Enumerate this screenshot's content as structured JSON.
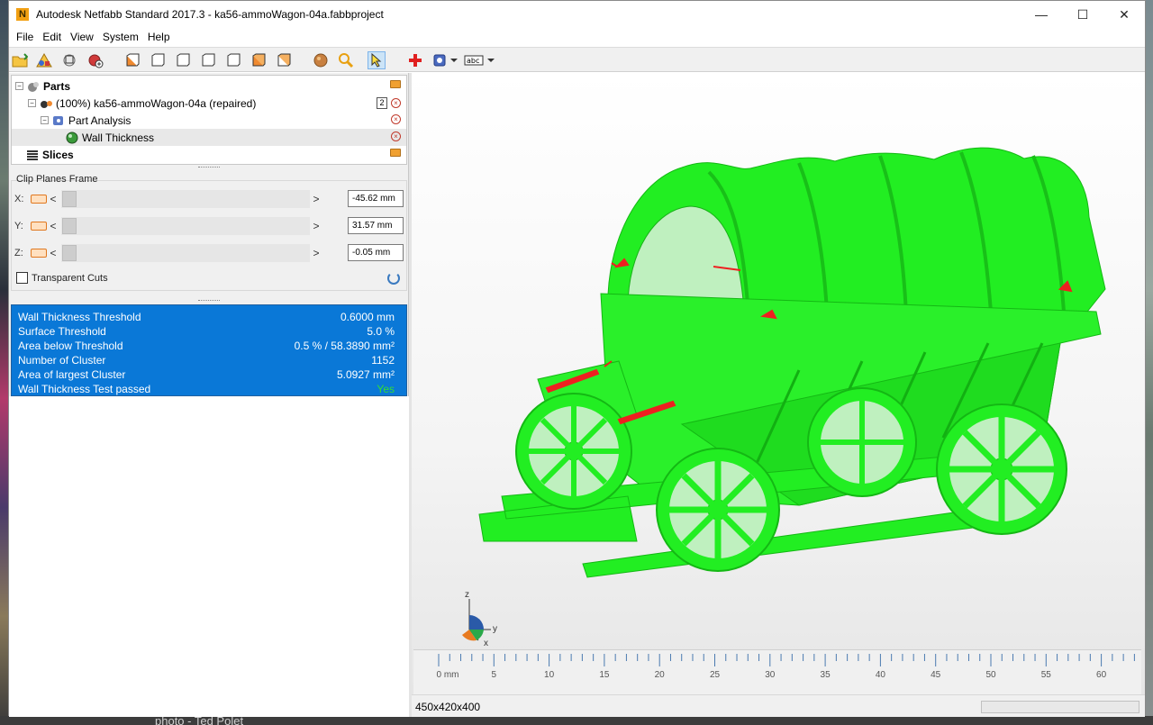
{
  "window": {
    "title": "Autodesk Netfabb Standard 2017.3 - ka56-ammoWagon-04a.fabbproject",
    "logo_letter": "N",
    "minimize": "—",
    "maximize": "☐",
    "close": "✕"
  },
  "menu": [
    "File",
    "Edit",
    "View",
    "System",
    "Help"
  ],
  "tree": {
    "parts_label": "Parts",
    "part_label": "(100%) ka56-ammoWagon-04a (repaired)",
    "part_badge": "2",
    "analysis_label": "Part Analysis",
    "wall_label": "Wall Thickness",
    "slices_label": "Slices"
  },
  "clip": {
    "title": "Clip Planes Frame",
    "x_label": "X:",
    "y_label": "Y:",
    "z_label": "Z:",
    "x_value": "-45.62 mm",
    "y_value": "31.57 mm",
    "z_value": "-0.05 mm",
    "arrow_left": "<",
    "arrow_right": ">",
    "transparent_label": "Transparent Cuts"
  },
  "results": [
    {
      "label": "Wall Thickness Threshold",
      "value": "0.6000 mm"
    },
    {
      "label": "Surface Threshold",
      "value": "5.0 %"
    },
    {
      "label": "Area below Threshold",
      "value": "0.5 % /  58.3890 mm²"
    },
    {
      "label": "Number of Cluster",
      "value": "1152"
    },
    {
      "label": "Area of largest Cluster",
      "value": "5.0927 mm²"
    },
    {
      "label": "Wall Thickness Test passed",
      "value": "Yes"
    }
  ],
  "ruler": {
    "labels": [
      "0 mm",
      "5",
      "10",
      "15",
      "20",
      "25",
      "30",
      "35",
      "40",
      "45",
      "50",
      "55",
      "60"
    ]
  },
  "axis": {
    "z": "z",
    "y": "y",
    "x": "x"
  },
  "status": {
    "dimensions": "450x420x400"
  },
  "colors": {
    "model_green": "#22ee22",
    "thin_red": "#ee2020",
    "results_bg": "#0a78d7"
  },
  "desktop": {
    "caption": "photo - Ted Polet"
  }
}
